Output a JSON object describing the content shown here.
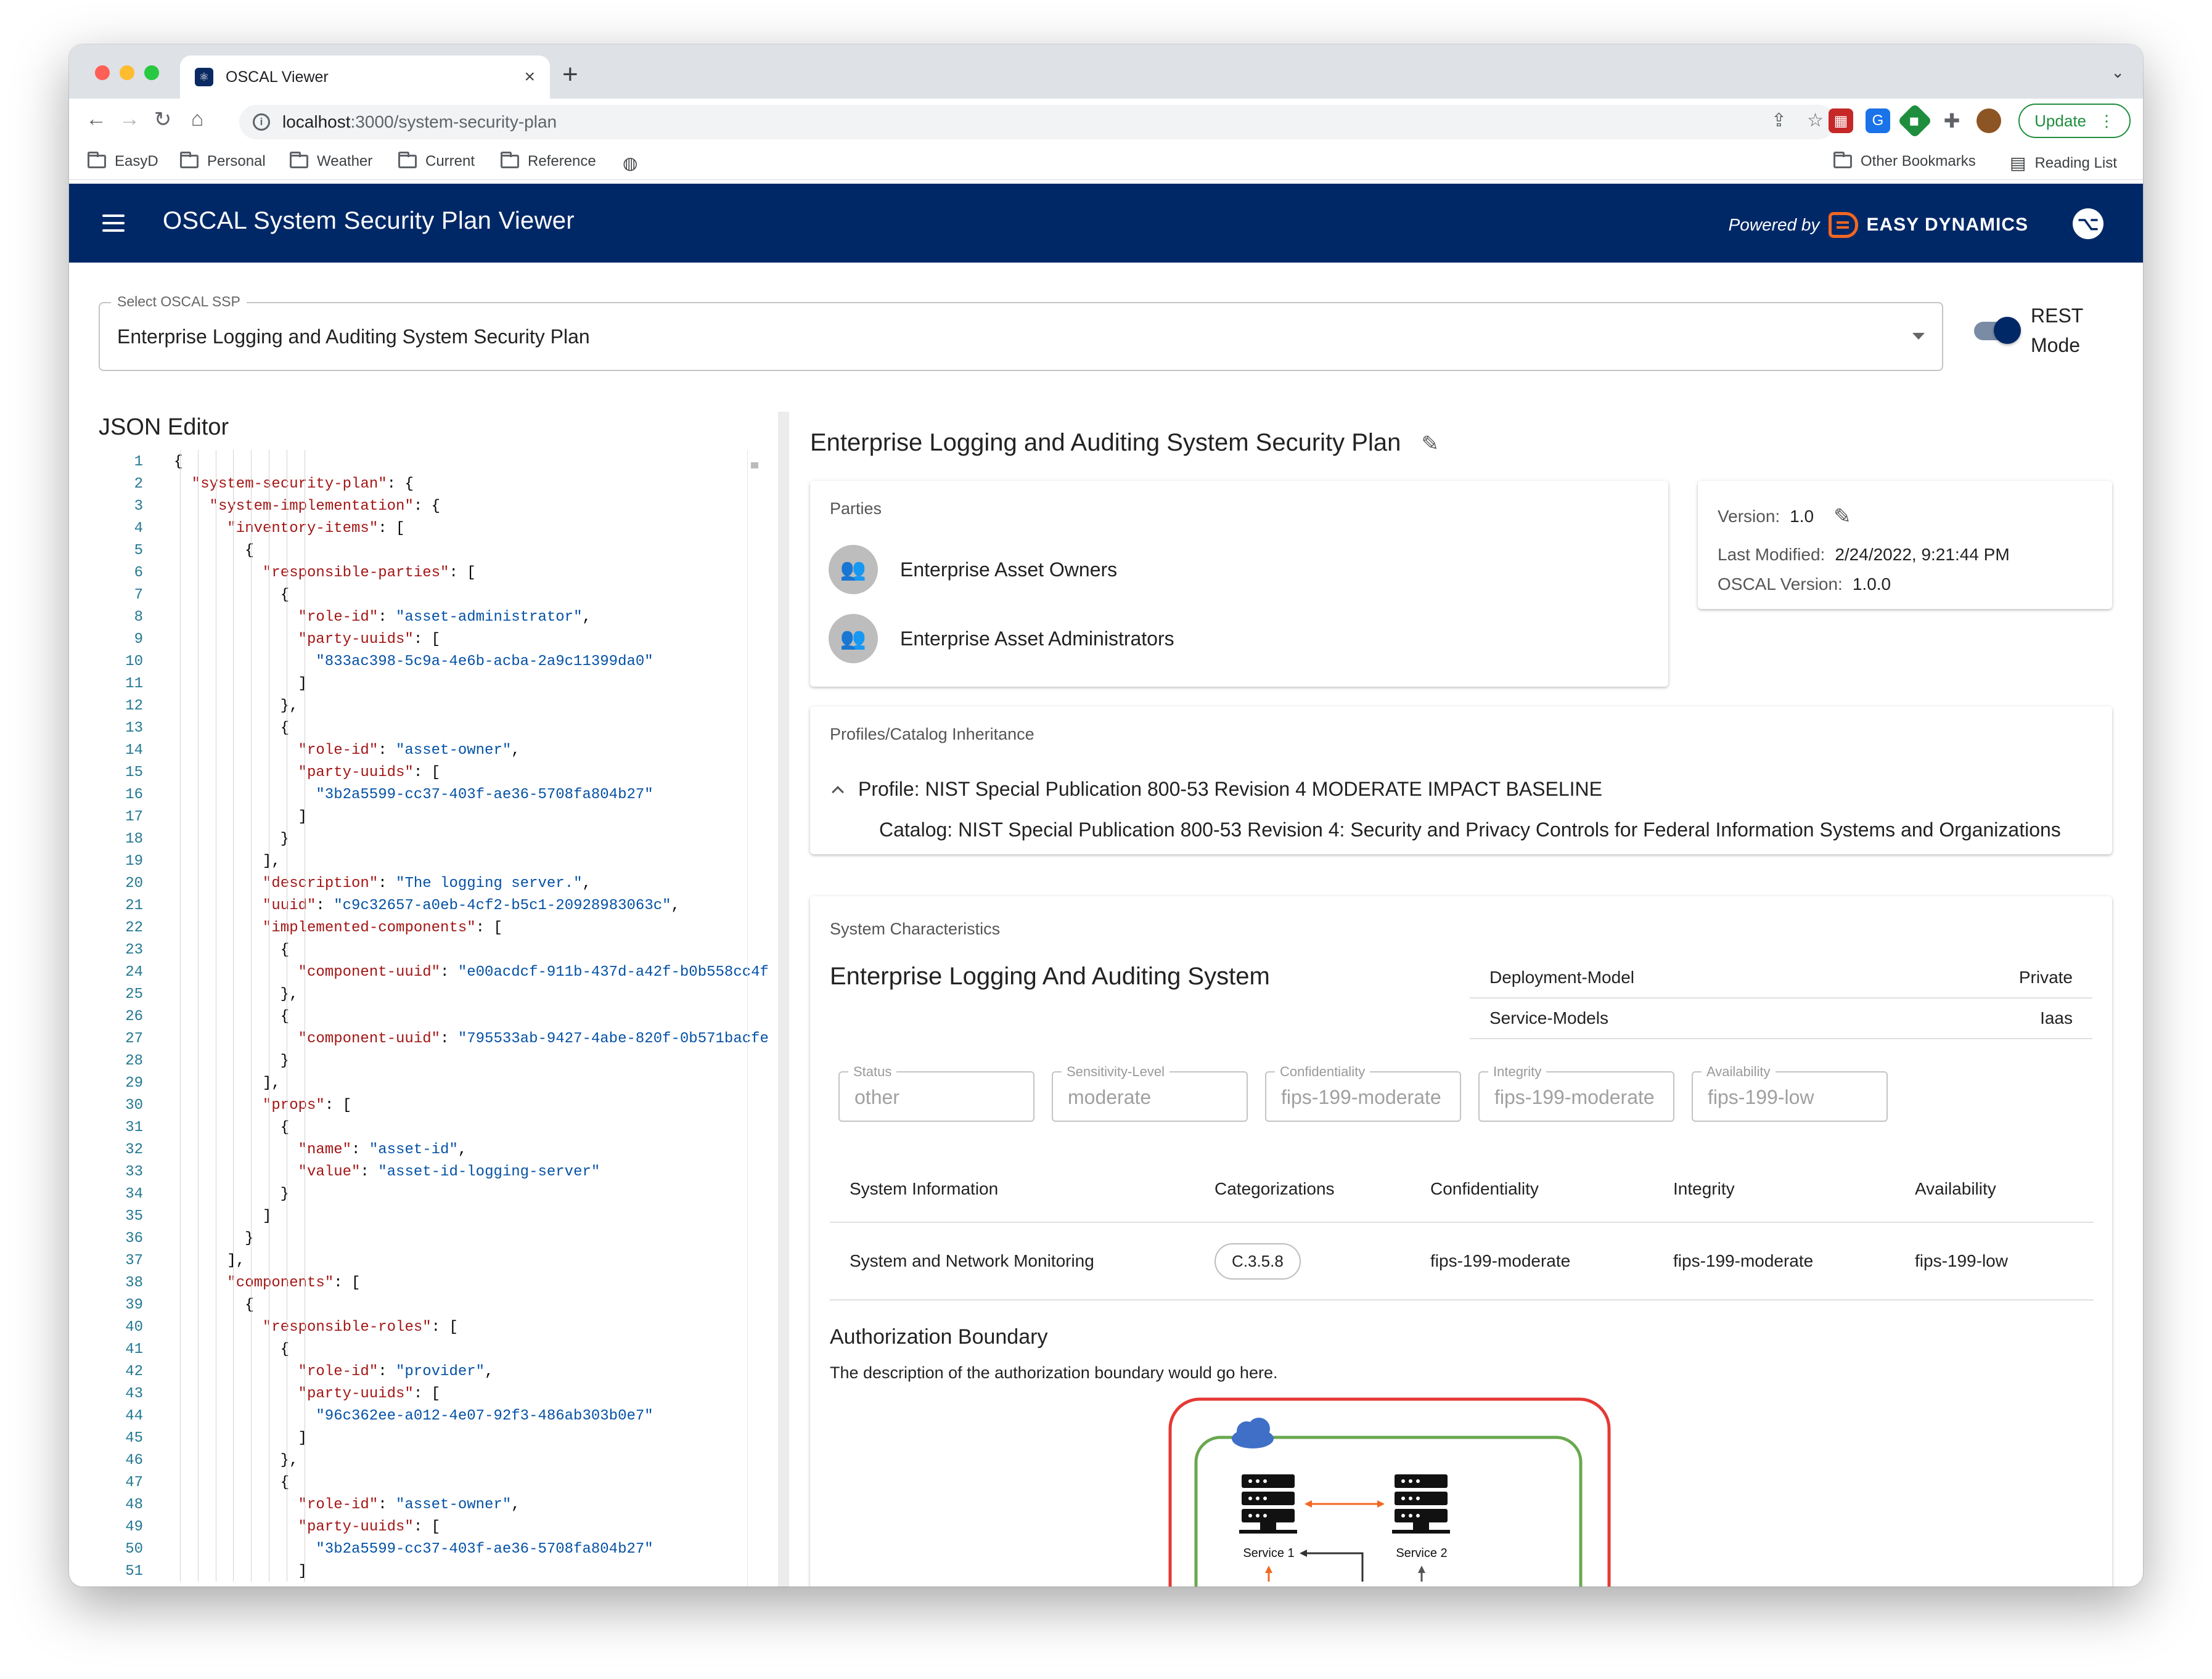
{
  "browser": {
    "tab_title": "OSCAL Viewer",
    "url_host": "localhost",
    "url_path": ":3000/system-security-plan",
    "update_label": "Update",
    "bookmarks": [
      "EasyD",
      "Personal",
      "Weather",
      "Current",
      "Reference"
    ],
    "other_bookmarks": "Other Bookmarks",
    "reading_list": "Reading List"
  },
  "appbar": {
    "title": "OSCAL System Security Plan Viewer",
    "powered_by": "Powered by",
    "brand": "EASY DYNAMICS"
  },
  "select": {
    "label": "Select OSCAL SSP",
    "value": "Enterprise Logging and Auditing System Security Plan"
  },
  "toggle": {
    "label_1": "REST",
    "label_2": "Mode",
    "on": true
  },
  "editor": {
    "title": "JSON Editor",
    "lines": [
      {
        "n": "1",
        "i": 0,
        "t": "{"
      },
      {
        "n": "2",
        "i": 1,
        "k": "\"system-security-plan\"",
        "t": ": {"
      },
      {
        "n": "3",
        "i": 2,
        "k": "\"system-implementation\"",
        "t": ": {"
      },
      {
        "n": "4",
        "i": 3,
        "k": "\"inventory-items\"",
        "t": ": ["
      },
      {
        "n": "5",
        "i": 4,
        "t": "{"
      },
      {
        "n": "6",
        "i": 5,
        "k": "\"responsible-parties\"",
        "t": ": ["
      },
      {
        "n": "7",
        "i": 6,
        "t": "{"
      },
      {
        "n": "8",
        "i": 7,
        "k": "\"role-id\"",
        "t": ": ",
        "s": "\"asset-administrator\"",
        "e": ","
      },
      {
        "n": "9",
        "i": 7,
        "k": "\"party-uuids\"",
        "t": ": ["
      },
      {
        "n": "10",
        "i": 8,
        "s": "\"833ac398-5c9a-4e6b-acba-2a9c11399da0\""
      },
      {
        "n": "11",
        "i": 7,
        "t": "]"
      },
      {
        "n": "12",
        "i": 6,
        "t": "},"
      },
      {
        "n": "13",
        "i": 6,
        "t": "{"
      },
      {
        "n": "14",
        "i": 7,
        "k": "\"role-id\"",
        "t": ": ",
        "s": "\"asset-owner\"",
        "e": ","
      },
      {
        "n": "15",
        "i": 7,
        "k": "\"party-uuids\"",
        "t": ": ["
      },
      {
        "n": "16",
        "i": 8,
        "s": "\"3b2a5599-cc37-403f-ae36-5708fa804b27\""
      },
      {
        "n": "17",
        "i": 7,
        "t": "]"
      },
      {
        "n": "18",
        "i": 6,
        "t": "}"
      },
      {
        "n": "19",
        "i": 5,
        "t": "],"
      },
      {
        "n": "20",
        "i": 5,
        "k": "\"description\"",
        "t": ": ",
        "s": "\"The logging server.\"",
        "e": ","
      },
      {
        "n": "21",
        "i": 5,
        "k": "\"uuid\"",
        "t": ": ",
        "s": "\"c9c32657-a0eb-4cf2-b5c1-20928983063c\"",
        "e": ","
      },
      {
        "n": "22",
        "i": 5,
        "k": "\"implemented-components\"",
        "t": ": ["
      },
      {
        "n": "23",
        "i": 6,
        "t": "{"
      },
      {
        "n": "24",
        "i": 7,
        "k": "\"component-uuid\"",
        "t": ": ",
        "s": "\"e00acdcf-911b-437d-a42f-b0b558cc4f"
      },
      {
        "n": "25",
        "i": 6,
        "t": "},"
      },
      {
        "n": "26",
        "i": 6,
        "t": "{"
      },
      {
        "n": "27",
        "i": 7,
        "k": "\"component-uuid\"",
        "t": ": ",
        "s": "\"795533ab-9427-4abe-820f-0b571bacfe"
      },
      {
        "n": "28",
        "i": 6,
        "t": "}"
      },
      {
        "n": "29",
        "i": 5,
        "t": "],"
      },
      {
        "n": "30",
        "i": 5,
        "k": "\"props\"",
        "t": ": ["
      },
      {
        "n": "31",
        "i": 6,
        "t": "{"
      },
      {
        "n": "32",
        "i": 7,
        "k": "\"name\"",
        "t": ": ",
        "s": "\"asset-id\"",
        "e": ","
      },
      {
        "n": "33",
        "i": 7,
        "k": "\"value\"",
        "t": ": ",
        "s": "\"asset-id-logging-server\""
      },
      {
        "n": "34",
        "i": 6,
        "t": "}"
      },
      {
        "n": "35",
        "i": 5,
        "t": "]"
      },
      {
        "n": "36",
        "i": 4,
        "t": "}"
      },
      {
        "n": "37",
        "i": 3,
        "t": "],"
      },
      {
        "n": "38",
        "i": 3,
        "k": "\"components\"",
        "t": ": ["
      },
      {
        "n": "39",
        "i": 4,
        "t": "{"
      },
      {
        "n": "40",
        "i": 5,
        "k": "\"responsible-roles\"",
        "t": ": ["
      },
      {
        "n": "41",
        "i": 6,
        "t": "{"
      },
      {
        "n": "42",
        "i": 7,
        "k": "\"role-id\"",
        "t": ": ",
        "s": "\"provider\"",
        "e": ","
      },
      {
        "n": "43",
        "i": 7,
        "k": "\"party-uuids\"",
        "t": ": ["
      },
      {
        "n": "44",
        "i": 8,
        "s": "\"96c362ee-a012-4e07-92f3-486ab303b0e7\""
      },
      {
        "n": "45",
        "i": 7,
        "t": "]"
      },
      {
        "n": "46",
        "i": 6,
        "t": "},"
      },
      {
        "n": "47",
        "i": 6,
        "t": "{"
      },
      {
        "n": "48",
        "i": 7,
        "k": "\"role-id\"",
        "t": ": ",
        "s": "\"asset-owner\"",
        "e": ","
      },
      {
        "n": "49",
        "i": 7,
        "k": "\"party-uuids\"",
        "t": ": ["
      },
      {
        "n": "50",
        "i": 8,
        "s": "\"3b2a5599-cc37-403f-ae36-5708fa804b27\""
      },
      {
        "n": "51",
        "i": 7,
        "t": "]"
      }
    ]
  },
  "ssp": {
    "title": "Enterprise Logging and Auditing System Security Plan",
    "parties": {
      "label": "Parties",
      "items": [
        "Enterprise Asset Owners",
        "Enterprise Asset Administrators"
      ]
    },
    "metadata": {
      "version_label": "Version:",
      "version": "1.0",
      "last_modified_label": "Last Modified:",
      "last_modified": "2/24/2022, 9:21:44 PM",
      "oscal_version_label": "OSCAL Version:",
      "oscal_version": "1.0.0"
    },
    "profiles": {
      "label": "Profiles/Catalog Inheritance",
      "profile": "Profile: NIST Special Publication 800-53 Revision 4 MODERATE IMPACT BASELINE",
      "catalog": "Catalog: NIST Special Publication 800-53 Revision 4: Security and Privacy Controls for Federal Information Systems and Organizations"
    },
    "characteristics": {
      "label": "System Characteristics",
      "system_name": "Enterprise Logging And Auditing System",
      "deployment_model_label": "Deployment-Model",
      "deployment_model": "Private",
      "service_models_label": "Service-Models",
      "service_models": "Iaas",
      "fields": [
        {
          "label": "Status",
          "value": "other"
        },
        {
          "label": "Sensitivity-Level",
          "value": "moderate"
        },
        {
          "label": "Confidentiality",
          "value": "fips-199-moderate"
        },
        {
          "label": "Integrity",
          "value": "fips-199-moderate"
        },
        {
          "label": "Availability",
          "value": "fips-199-low"
        }
      ],
      "table_headers": [
        "System Information",
        "Categorizations",
        "Confidentiality",
        "Integrity",
        "Availability"
      ],
      "table_row": [
        "System and Network Monitoring",
        "C.3.5.8",
        "fips-199-moderate",
        "fips-199-moderate",
        "fips-199-low"
      ],
      "boundary_title": "Authorization Boundary",
      "boundary_desc": "The description of the authorization boundary would go here.",
      "diagram_labels": [
        "Service 1",
        "Service 2"
      ]
    }
  }
}
